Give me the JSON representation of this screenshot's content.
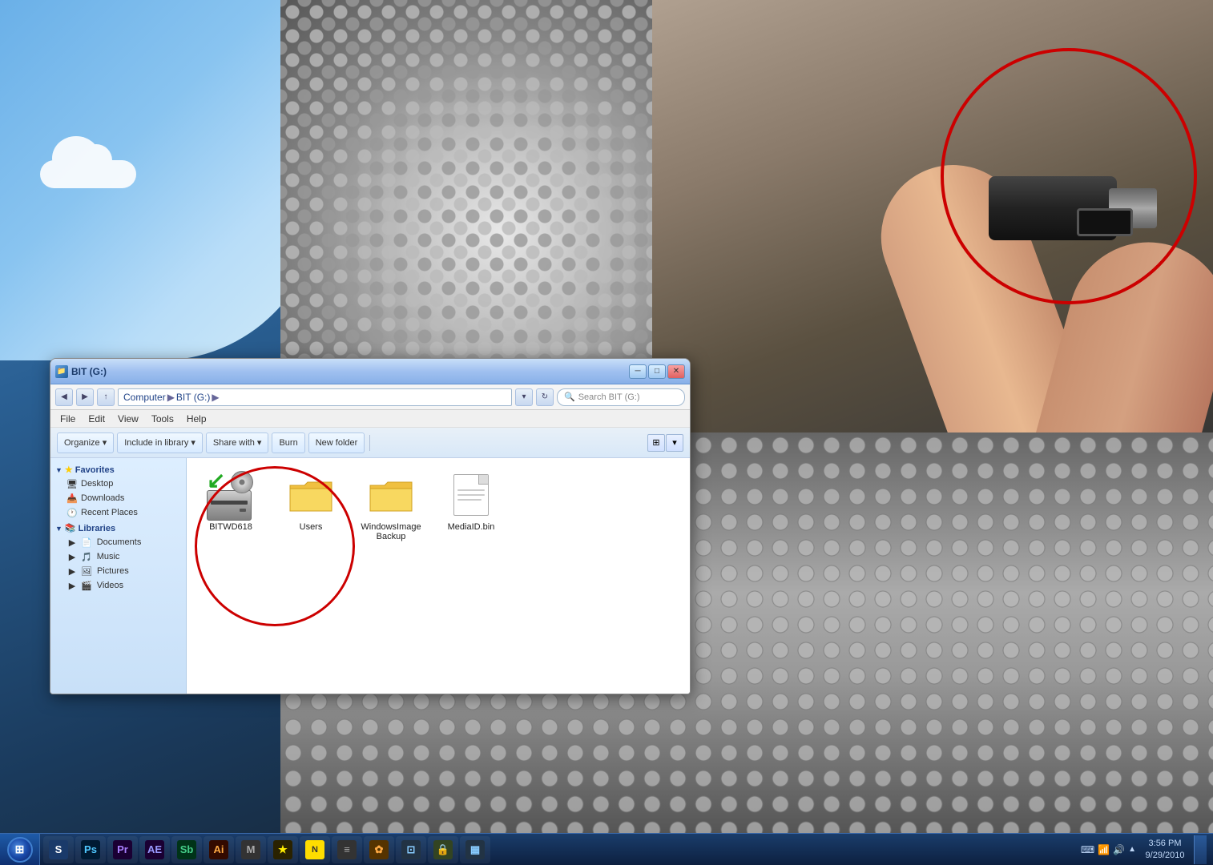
{
  "desktop": {
    "bg_description": "Windows 7 desktop with USB drive photo"
  },
  "explorer": {
    "title": "BIT (G:)",
    "window_title": "BIT (G:)",
    "breadcrumb": {
      "parts": [
        "Computer",
        "BIT (G:)"
      ],
      "full": "Computer ▶ BIT (G:) ▶"
    },
    "search_placeholder": "Search BIT (G:)",
    "menu": {
      "items": [
        "File",
        "Edit",
        "View",
        "Tools",
        "Help"
      ]
    },
    "toolbar": {
      "organize_label": "Organize ▾",
      "include_in_library_label": "Include in library ▾",
      "share_with_label": "Share with ▾",
      "burn_label": "Burn",
      "new_folder_label": "New folder"
    },
    "sidebar": {
      "favorites_label": "Favorites",
      "desktop_label": "Desktop",
      "downloads_label": "Downloads",
      "recent_places_label": "Recent Places",
      "libraries_label": "Libraries",
      "documents_label": "Documents",
      "music_label": "Music",
      "pictures_label": "Pictures",
      "videos_label": "Videos"
    },
    "files": [
      {
        "name": "BITWD618",
        "type": "drive",
        "highlighted": true
      },
      {
        "name": "Users",
        "type": "folder"
      },
      {
        "name": "WindowsImageBackup",
        "type": "folder"
      },
      {
        "name": "MediaID.bin",
        "type": "file"
      }
    ]
  },
  "taskbar": {
    "time": "3:56 PM",
    "date": "9/29/2010",
    "apps": [
      {
        "icon": "⊞",
        "label": "Start",
        "color": "#1a4a9a"
      },
      {
        "icon": "S",
        "label": "Steam",
        "color": "#1a3a6a"
      },
      {
        "icon": "Ps",
        "label": "Photoshop",
        "color": "#001a33"
      },
      {
        "icon": "Pr",
        "label": "Premiere",
        "color": "#1a0033"
      },
      {
        "icon": "AE",
        "label": "After Effects",
        "color": "#1a0033"
      },
      {
        "icon": "Sb",
        "label": "Soundbooth",
        "color": "#003318"
      },
      {
        "icon": "Ai",
        "label": "Illustrator",
        "color": "#330a00"
      },
      {
        "icon": "M",
        "label": "App",
        "color": "#222"
      },
      {
        "icon": "★",
        "label": "App",
        "color": "#2a2200"
      },
      {
        "icon": "N",
        "label": "Norton",
        "color": "#ffdd00"
      },
      {
        "icon": "≡",
        "label": "App",
        "color": "#333"
      },
      {
        "icon": "✿",
        "label": "App",
        "color": "#553300"
      },
      {
        "icon": "⊡",
        "label": "App",
        "color": "#334422"
      },
      {
        "icon": "🔒",
        "label": "App",
        "color": "#333"
      },
      {
        "icon": "▦",
        "label": "App",
        "color": "#223344"
      }
    ],
    "tray_icons": [
      "🔊",
      "📶",
      "⌨"
    ]
  }
}
